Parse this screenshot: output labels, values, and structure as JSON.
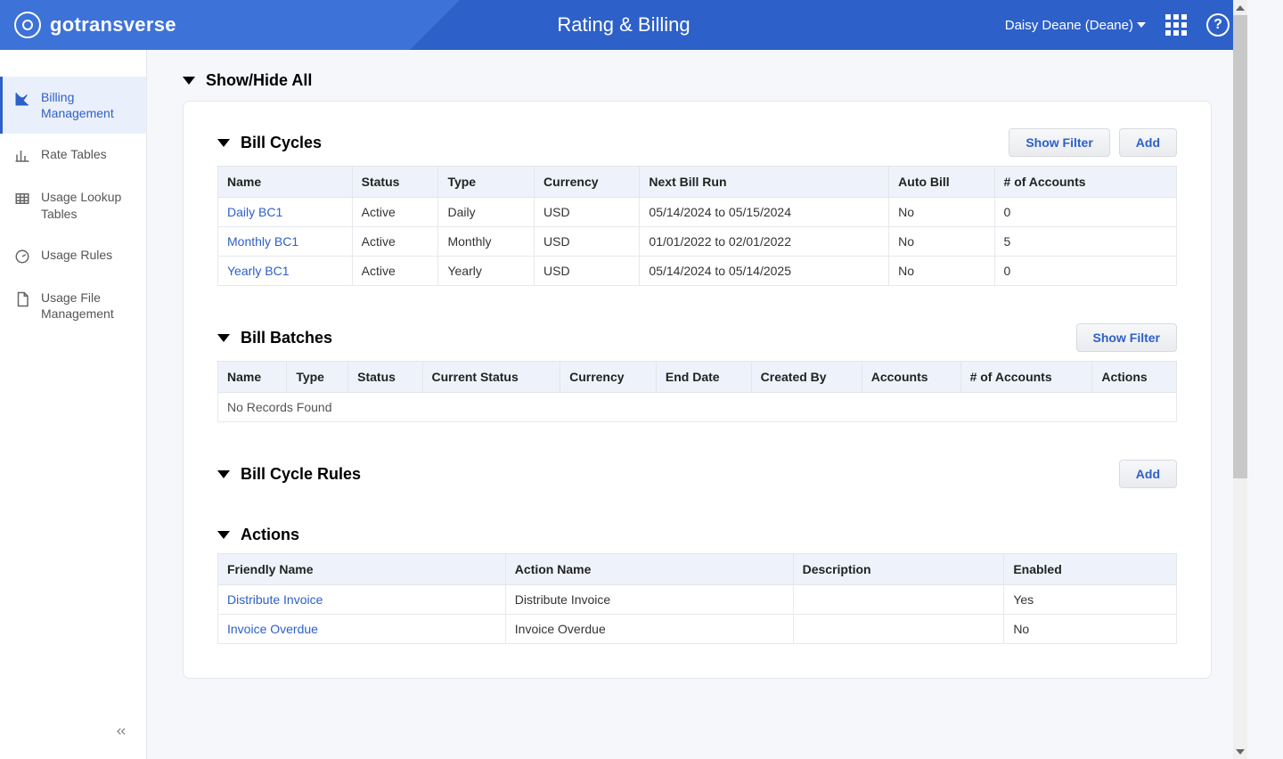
{
  "header": {
    "brand": "gotransverse",
    "title": "Rating & Billing",
    "user": "Daisy Deane (Deane)"
  },
  "sidebar": {
    "items": [
      {
        "label": "Billing Management",
        "icon": "chart-line"
      },
      {
        "label": "Rate Tables",
        "icon": "bar-chart"
      },
      {
        "label": "Usage Lookup Tables",
        "icon": "table"
      },
      {
        "label": "Usage Rules",
        "icon": "gauge"
      },
      {
        "label": "Usage File Management",
        "icon": "file"
      }
    ]
  },
  "top_section": {
    "title": "Show/Hide All"
  },
  "panels": {
    "bill_cycles": {
      "title": "Bill Cycles",
      "show_filter": "Show Filter",
      "add": "Add",
      "columns": [
        "Name",
        "Status",
        "Type",
        "Currency",
        "Next Bill Run",
        "Auto Bill",
        "# of Accounts"
      ],
      "rows": [
        {
          "name": "Daily BC1",
          "status": "Active",
          "type": "Daily",
          "currency": "USD",
          "next_run": "05/14/2024 to 05/15/2024",
          "auto": "No",
          "accounts": "0"
        },
        {
          "name": "Monthly BC1",
          "status": "Active",
          "type": "Monthly",
          "currency": "USD",
          "next_run": "01/01/2022 to 02/01/2022",
          "auto": "No",
          "accounts": "5"
        },
        {
          "name": "Yearly BC1",
          "status": "Active",
          "type": "Yearly",
          "currency": "USD",
          "next_run": "05/14/2024 to 05/14/2025",
          "auto": "No",
          "accounts": "0"
        }
      ]
    },
    "bill_batches": {
      "title": "Bill Batches",
      "show_filter": "Show Filter",
      "columns": [
        "Name",
        "Type",
        "Status",
        "Current Status",
        "Currency",
        "End Date",
        "Created By",
        "Accounts",
        "# of Accounts",
        "Actions"
      ],
      "empty": "No Records Found"
    },
    "bill_cycle_rules": {
      "title": "Bill Cycle Rules",
      "add": "Add"
    },
    "actions": {
      "title": "Actions",
      "columns": [
        "Friendly Name",
        "Action Name",
        "Description",
        "Enabled"
      ],
      "rows": [
        {
          "friendly": "Distribute Invoice",
          "action": "Distribute Invoice",
          "desc": "",
          "enabled": "Yes"
        },
        {
          "friendly": "Invoice Overdue",
          "action": "Invoice Overdue",
          "desc": "",
          "enabled": "No"
        }
      ]
    }
  }
}
